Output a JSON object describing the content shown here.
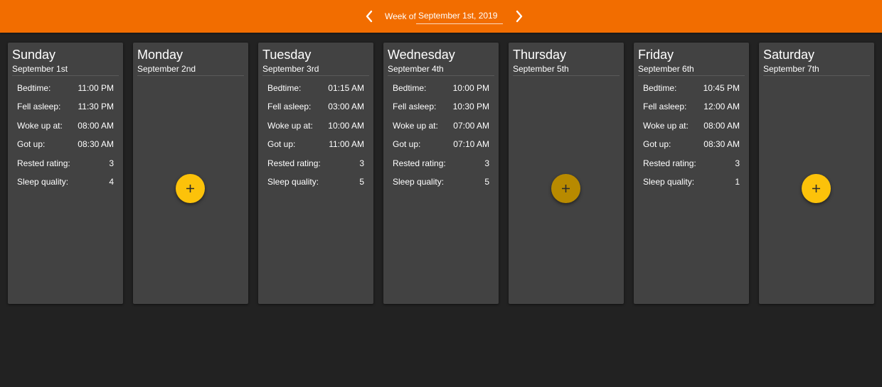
{
  "header": {
    "week_prefix": "Week of",
    "week_value": "September 1st, 2019",
    "prev_icon": "chevron-left-icon",
    "next_icon": "chevron-right-icon",
    "bar_color": "#f26d00"
  },
  "labels": {
    "bedtime": "Bedtime:",
    "fell_asleep": "Fell asleep:",
    "woke_up": "Woke up at:",
    "got_up": "Got up:",
    "rested": "Rested rating:",
    "quality": "Sleep quality:"
  },
  "add_icon": "plus-icon",
  "accent_color": "#fcc20a",
  "days": [
    {
      "name": "Sunday",
      "date": "September 1st",
      "entry": {
        "bedtime": "11:00 PM",
        "fell_asleep": "11:30 PM",
        "woke_up": "08:00 AM",
        "got_up": "08:30 AM",
        "rested": "3",
        "quality": "4"
      }
    },
    {
      "name": "Monday",
      "date": "September 2nd",
      "entry": null
    },
    {
      "name": "Tuesday",
      "date": "September 3rd",
      "entry": {
        "bedtime": "01:15 AM",
        "fell_asleep": "03:00 AM",
        "woke_up": "10:00 AM",
        "got_up": "11:00 AM",
        "rested": "3",
        "quality": "5"
      }
    },
    {
      "name": "Wednesday",
      "date": "September 4th",
      "entry": {
        "bedtime": "10:00 PM",
        "fell_asleep": "10:30 PM",
        "woke_up": "07:00 AM",
        "got_up": "07:10 AM",
        "rested": "3",
        "quality": "5"
      }
    },
    {
      "name": "Thursday",
      "date": "September 5th",
      "entry": null
    },
    {
      "name": "Friday",
      "date": "September 6th",
      "entry": {
        "bedtime": "10:45 PM",
        "fell_asleep": "12:00 AM",
        "woke_up": "08:00 AM",
        "got_up": "08:30 AM",
        "rested": "3",
        "quality": "1"
      }
    },
    {
      "name": "Saturday",
      "date": "September 7th",
      "entry": null
    }
  ]
}
